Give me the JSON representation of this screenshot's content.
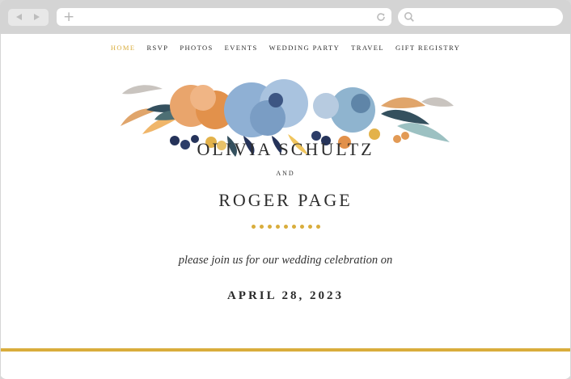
{
  "browser": {
    "back_icon": "back-arrow-icon",
    "forward_icon": "forward-arrow-icon",
    "new_tab_icon": "plus-icon",
    "reload_icon": "reload-icon",
    "search_icon": "search-icon",
    "url": ""
  },
  "nav": {
    "items": [
      "HOME",
      "RSVP",
      "PHOTOS",
      "EVENTS",
      "WEDDING PARTY",
      "TRAVEL",
      "GIFT REGISTRY"
    ],
    "active_index": 0
  },
  "couple": {
    "name_one": "OLIVIA SCHULTZ",
    "conjunction": "AND",
    "name_two": "ROGER PAGE"
  },
  "invitation": "please join us for our wedding celebration on",
  "date": "APRIL 28, 2023",
  "colors": {
    "accent_gold": "#d9ad3c",
    "text_dark": "#2d2d2d",
    "floral_blue": "#8fb0d4",
    "floral_orange": "#e29a55",
    "floral_navy": "#25335a"
  }
}
